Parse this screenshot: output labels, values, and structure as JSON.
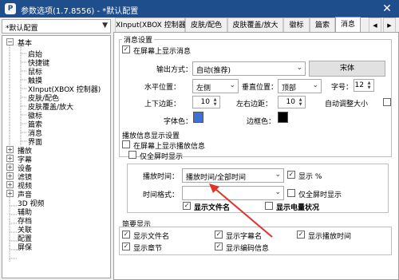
{
  "window": {
    "title": "参数选项(1.7.8556) - *默认配置",
    "close_glyph": "✕",
    "app_icon_text": "P"
  },
  "profile_select": {
    "value": "*默认配置"
  },
  "tree": {
    "items": [
      {
        "label": "基本",
        "expander": "−"
      },
      {
        "label": "启始"
      },
      {
        "label": "快捷键"
      },
      {
        "label": "鼠标"
      },
      {
        "label": "触摸"
      },
      {
        "label": "XInput(XBOX 控制器)"
      },
      {
        "label": "皮肤/配色"
      },
      {
        "label": "皮肤覆盖/放大"
      },
      {
        "label": "徽标"
      },
      {
        "label": "篇索"
      },
      {
        "label": "消息"
      },
      {
        "label": "界面"
      },
      {
        "label": "播放",
        "expander": "+"
      },
      {
        "label": "字幕",
        "expander": "+"
      },
      {
        "label": "设备",
        "expander": "+"
      },
      {
        "label": "滤镜",
        "expander": "+"
      },
      {
        "label": "视频",
        "expander": "+"
      },
      {
        "label": "声音",
        "expander": "+"
      },
      {
        "label": "3D 视频"
      },
      {
        "label": "辅助"
      },
      {
        "label": "存档"
      },
      {
        "label": "关联"
      },
      {
        "label": "配置"
      },
      {
        "label": "屏保"
      }
    ]
  },
  "tabs": [
    {
      "label": "XInput(XBOX 控制器)"
    },
    {
      "label": "皮肤/配色"
    },
    {
      "label": "皮肤覆盖/放大"
    },
    {
      "label": "徽标"
    },
    {
      "label": "篇索"
    },
    {
      "label": "消息",
      "active": true
    },
    {
      "label": "◀"
    },
    {
      "label": "▶"
    }
  ],
  "message_settings": {
    "group_title": "消息设置",
    "show_on_screen": {
      "label": "在屏幕上显示消息",
      "checked": true
    },
    "output_method": {
      "label": "输出方式：",
      "value": "自动(推荐)"
    },
    "font_button": "宋体",
    "h_position": {
      "label": "水平位置：",
      "value": "左侧"
    },
    "v_position": {
      "label": "垂直位置：",
      "value": "顶部"
    },
    "font_size": {
      "label": "字号：",
      "value": "12"
    },
    "margin_tb": {
      "label": "上下边距：",
      "value": "10"
    },
    "margin_lr": {
      "label": "左右边距：",
      "value": "10"
    },
    "auto_adjust": {
      "label": "自动调整大小",
      "checked": false
    },
    "font_color": {
      "label": "字体色：",
      "color": "#3f6fd8"
    },
    "border_color": {
      "label": "边框色：",
      "color": "#000000"
    }
  },
  "playback_info": {
    "group_title": "播放信息显示设置",
    "show_on_screen": {
      "label": "在屏幕上显示播放信息",
      "checked": false
    },
    "fullscreen_only": {
      "label": "仅全屏时显示",
      "checked": false
    },
    "play_time": {
      "label": "播放时间：",
      "value": "播放时间/全部时间"
    },
    "show_percent": {
      "label": "显示 %",
      "checked": true
    },
    "time_format": {
      "label": "时间格式：",
      "value": ""
    },
    "time_fullscreen_only": {
      "label": "仅全屏时显示",
      "checked": false
    },
    "show_filename": {
      "label": "显示文件名",
      "checked": true
    },
    "show_battery": {
      "label": "显示电量状况",
      "checked": false
    }
  },
  "brief_display": {
    "group_title": "简要显示",
    "items": [
      {
        "label": "显示文件名",
        "checked": true
      },
      {
        "label": "显示字幕名",
        "checked": true
      },
      {
        "label": "显示播放时间",
        "checked": true
      },
      {
        "label": "显示章节",
        "checked": true
      },
      {
        "label": "显示编码信息",
        "checked": true
      }
    ]
  },
  "annotation": {
    "arrow_color": "#e0322b"
  }
}
